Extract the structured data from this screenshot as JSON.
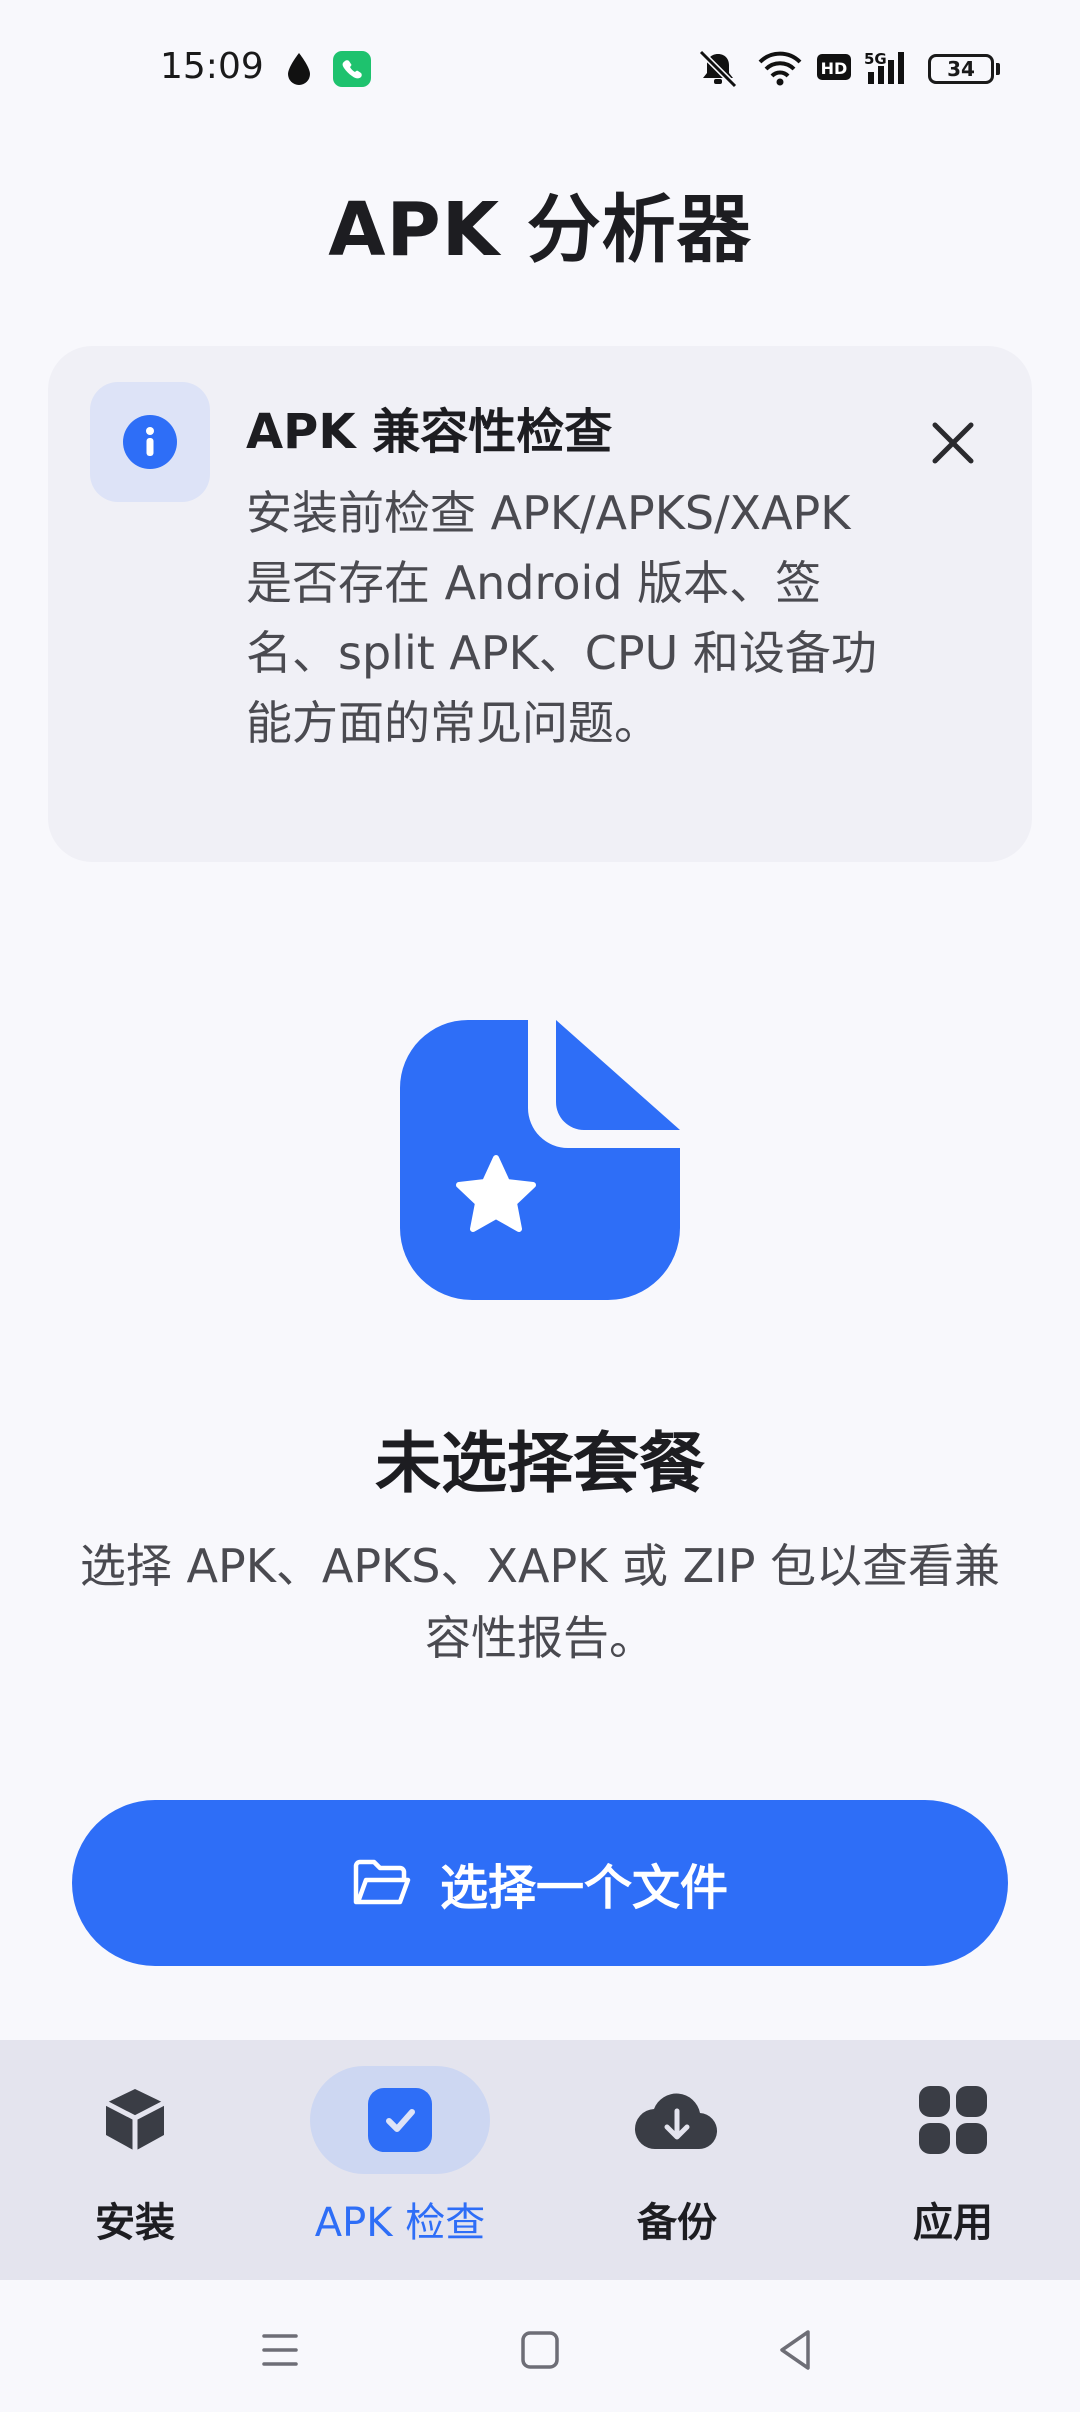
{
  "status_bar": {
    "time": "15:09",
    "battery": "34",
    "icons": [
      "water-drop-icon",
      "phone-call-icon",
      "mute-icon",
      "wifi-icon",
      "hd-icon",
      "5g-signal-icon",
      "battery-icon"
    ]
  },
  "header": {
    "title": "APK 分析器"
  },
  "info_card": {
    "icon": "info-icon",
    "title": "APK 兼容性检查",
    "body": "安装前检查 APK/APKS/XAPK 是否存在 Android 版本、签名、split APK、CPU 和设备功能方面的常见问题。",
    "close_icon": "close-icon"
  },
  "empty_state": {
    "icon": "file-star-icon",
    "title": "未选择套餐",
    "description": "选择 APK、APKS、XAPK 或 ZIP 包以查看兼容性报告。"
  },
  "primary_action": {
    "icon": "folder-open-icon",
    "label": "选择一个文件"
  },
  "bottom_nav": {
    "items": [
      {
        "label": "安装",
        "icon": "box-icon",
        "active": false
      },
      {
        "label": "APK 检查",
        "icon": "check-square-icon",
        "active": true
      },
      {
        "label": "备份",
        "icon": "cloud-download-icon",
        "active": false
      },
      {
        "label": "应用",
        "icon": "apps-grid-icon",
        "active": false
      }
    ]
  },
  "system_nav": {
    "icons": [
      "menu-icon",
      "home-icon",
      "back-icon"
    ]
  },
  "colors": {
    "accent": "#2e6ef7",
    "background": "#f8f8fc",
    "card": "#f0f0f6",
    "nav_background": "#e4e4ee",
    "active_pill": "#cdd7f2"
  }
}
